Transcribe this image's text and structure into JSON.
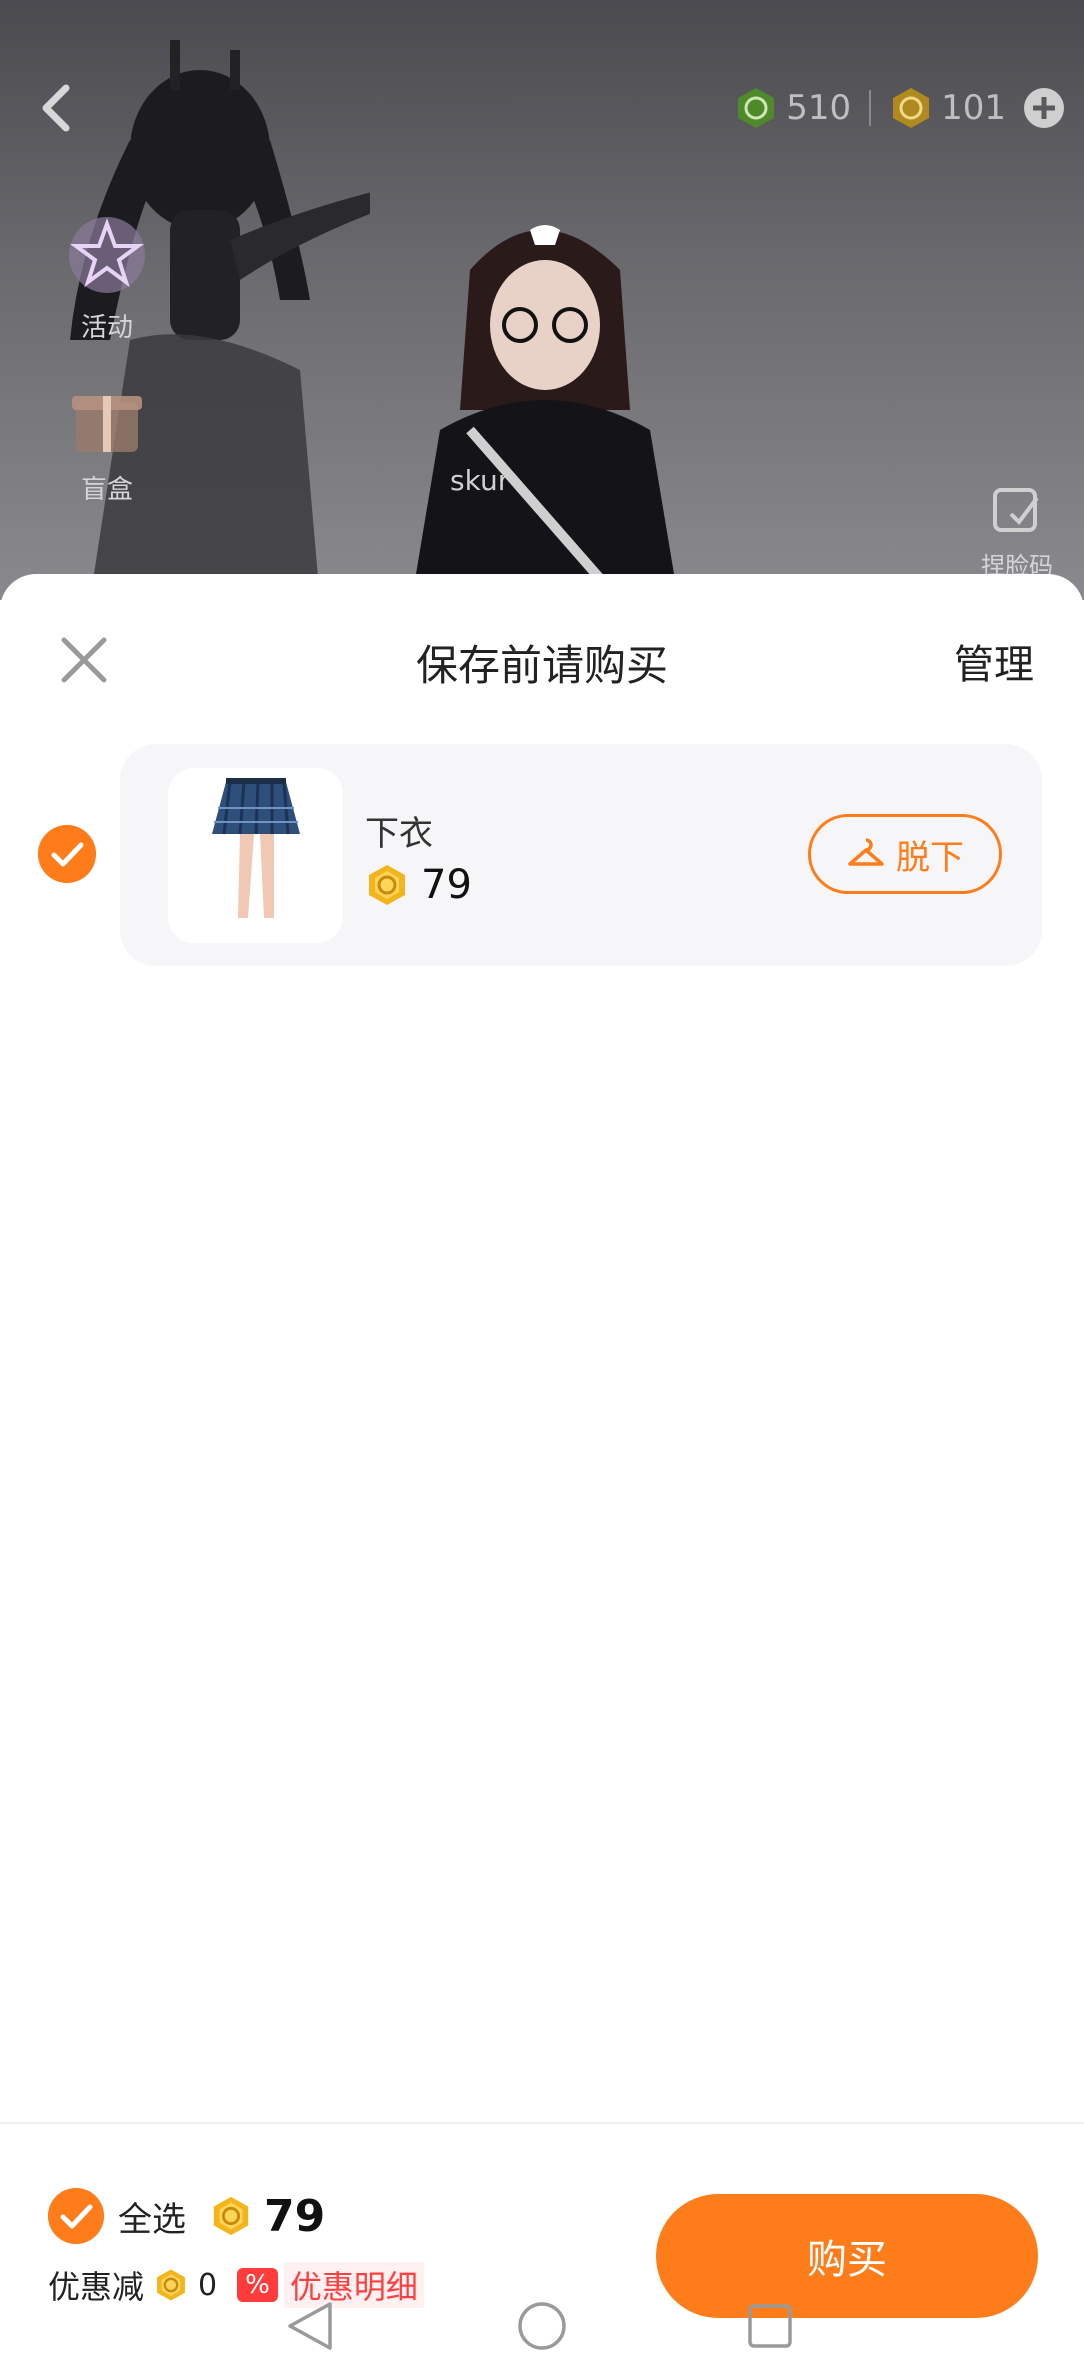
{
  "header_overlay": {
    "currency_green": "510",
    "currency_gold": "101",
    "side_menu": [
      {
        "label": "活动",
        "icon": "star-badge-icon"
      },
      {
        "label": "盲盒",
        "icon": "gift-box-icon"
      }
    ],
    "face_button": "捏脸码"
  },
  "sheet": {
    "title": "保存前请购买",
    "manage_label": "管理",
    "items": [
      {
        "name": "下衣",
        "price": "79",
        "action_label": "脱下",
        "checked": true
      }
    ]
  },
  "footer": {
    "select_all_label": "全选",
    "total": "79",
    "discount_label": "优惠减",
    "discount_value": "0",
    "percent_tag": "%",
    "discount_detail_label": "优惠明细",
    "buy_label": "购买"
  },
  "colors": {
    "accent": "#ff7c1b",
    "coin_gold": "#f2b51c",
    "coin_green": "#5a9a2a",
    "discount_red": "#ff3b3b"
  }
}
